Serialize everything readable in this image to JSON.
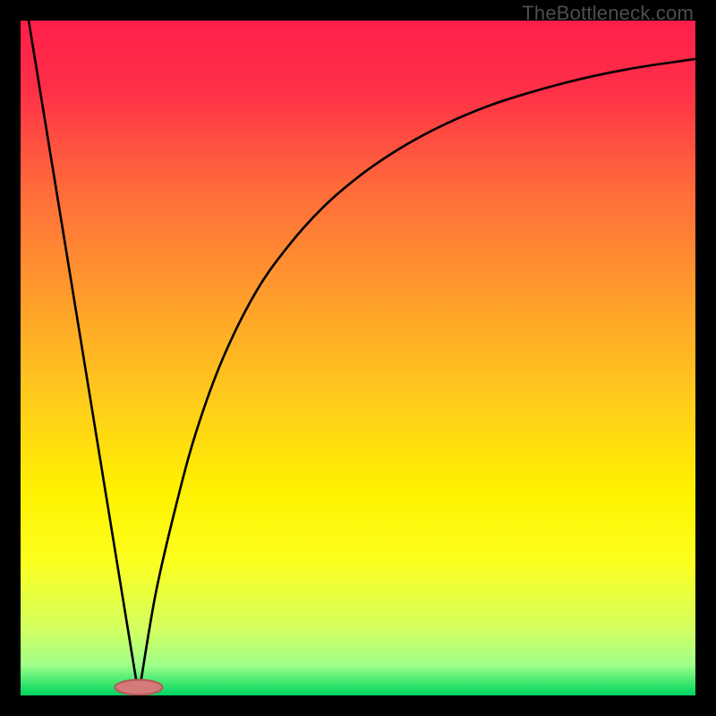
{
  "watermark": "TheBottleneck.com",
  "gradient_stops": [
    {
      "offset": 0.0,
      "color": "#ff1f4a"
    },
    {
      "offset": 0.1,
      "color": "#ff2f47"
    },
    {
      "offset": 0.25,
      "color": "#ff6b3b"
    },
    {
      "offset": 0.4,
      "color": "#ff9a2c"
    },
    {
      "offset": 0.55,
      "color": "#ffc81d"
    },
    {
      "offset": 0.7,
      "color": "#fff200"
    },
    {
      "offset": 0.8,
      "color": "#fdff1f"
    },
    {
      "offset": 0.9,
      "color": "#d4ff5e"
    },
    {
      "offset": 0.955,
      "color": "#9fff8a"
    },
    {
      "offset": 0.985,
      "color": "#30e46b"
    },
    {
      "offset": 1.0,
      "color": "#00d563"
    }
  ],
  "marker": {
    "cx": 0.175,
    "cy": 0.988,
    "rx": 0.035,
    "ry": 0.011,
    "fill": "#d47a7a",
    "stroke": "#b55a5a"
  },
  "chart_data": {
    "type": "line",
    "title": "",
    "xlabel": "",
    "ylabel": "",
    "xlim": [
      0,
      1
    ],
    "ylim": [
      0,
      1
    ],
    "series": [
      {
        "name": "left-line",
        "x": [
          0.012,
          0.175
        ],
        "y": [
          1.0,
          0.0
        ]
      },
      {
        "name": "right-curve",
        "x": [
          0.175,
          0.2,
          0.23,
          0.26,
          0.3,
          0.35,
          0.4,
          0.45,
          0.5,
          0.55,
          0.6,
          0.65,
          0.7,
          0.75,
          0.8,
          0.85,
          0.9,
          0.95,
          1.0
        ],
        "y": [
          0.0,
          0.15,
          0.28,
          0.39,
          0.5,
          0.6,
          0.67,
          0.725,
          0.768,
          0.803,
          0.832,
          0.856,
          0.876,
          0.892,
          0.906,
          0.918,
          0.928,
          0.936,
          0.943
        ]
      }
    ],
    "optimal_point": {
      "x": 0.175,
      "y": 0.0
    }
  }
}
